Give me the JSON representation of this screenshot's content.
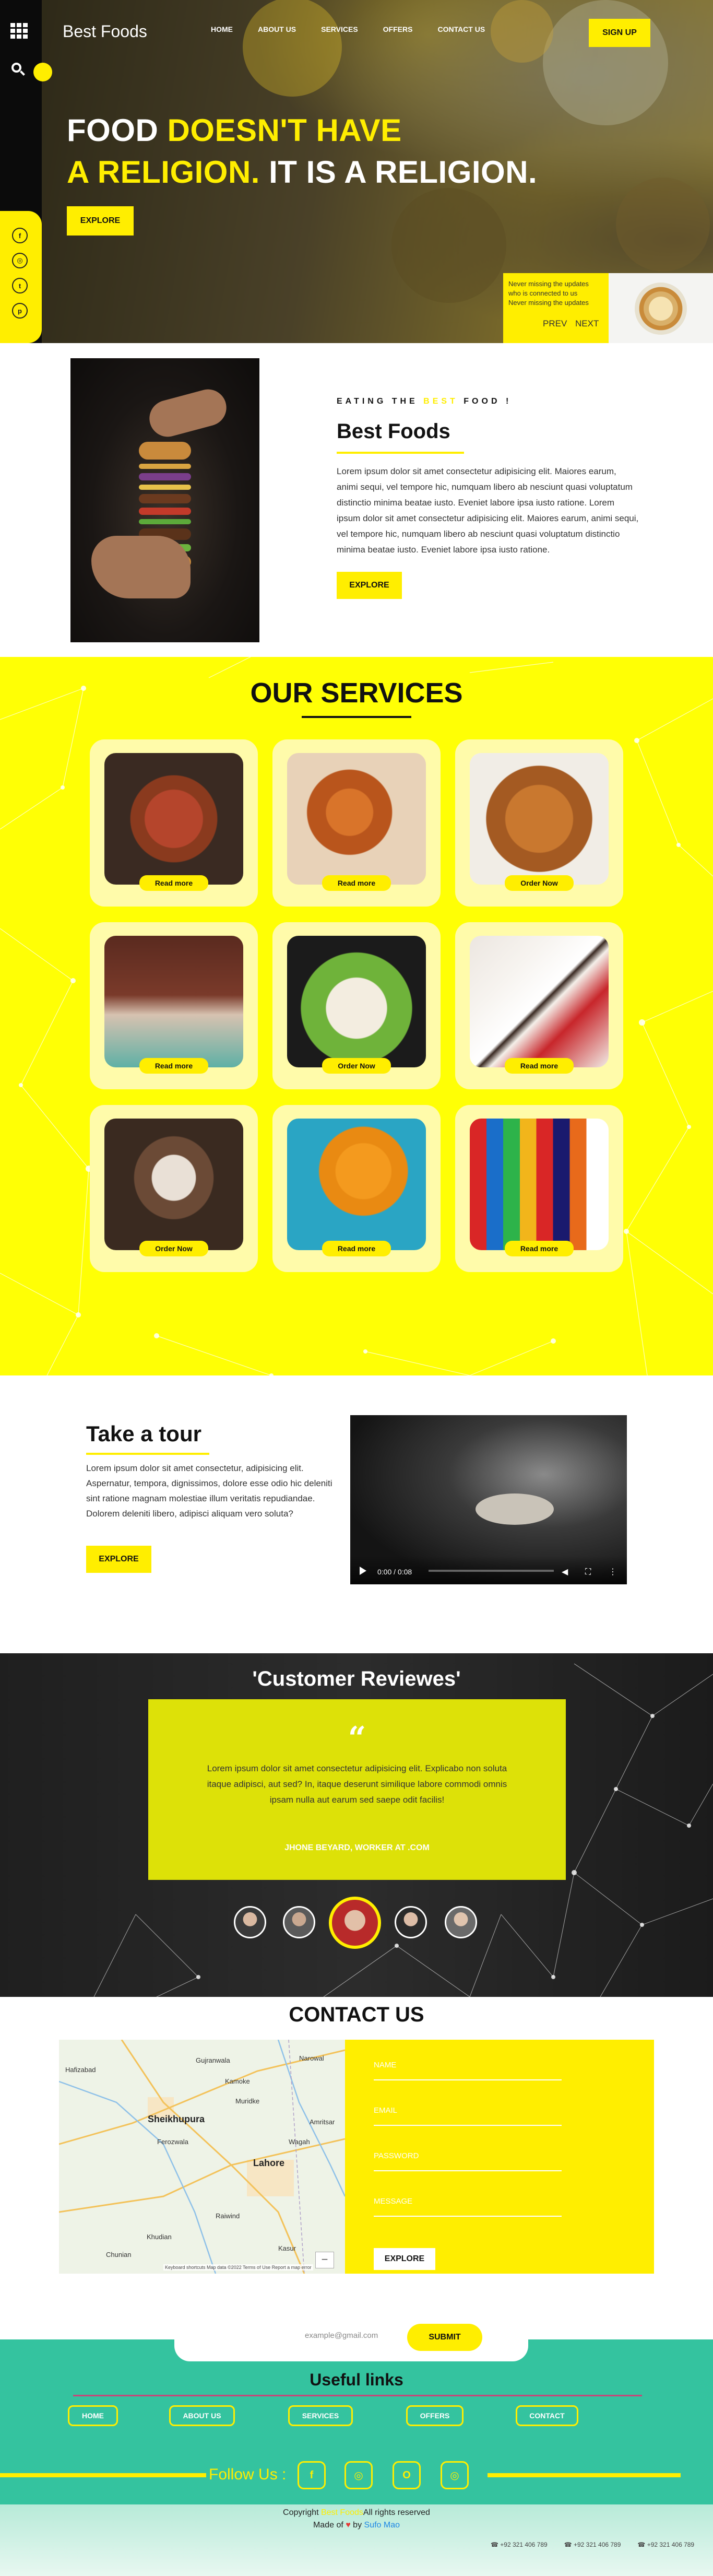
{
  "header": {
    "brand": "Best Foods",
    "nav": [
      "HOME",
      "ABOUT US",
      "SERVICES",
      "OFFERS",
      "CONTACT US"
    ],
    "signup": "SIGN UP"
  },
  "hero": {
    "line1_white": "FOOD ",
    "line1_yellow": "DOESN'T HAVE",
    "line2_yellow": "A RELIGION.",
    "line2_white": " IT IS A RELIGION.",
    "explore": "EXPLORE",
    "social": [
      "f",
      "◎",
      "t",
      "p"
    ],
    "update_lines": [
      "Never missing the updates",
      "who is connected to us",
      "Never missing the updates"
    ],
    "prev": "PREV",
    "next": "NEXT"
  },
  "about": {
    "eyebrow_1": "EATING THE ",
    "eyebrow_yellow": "BEST",
    "eyebrow_2": " FOOD !",
    "title": "Best Foods",
    "text": "Lorem ipsum dolor sit amet consectetur adipisicing elit. Maiores earum, animi sequi, vel tempore hic, numquam libero ab nesciunt quasi voluptatum distinctio minima beatae iusto. Eveniet labore ipsa iusto ratione. Lorem ipsum dolor sit amet consectetur adipisicing elit. Maiores earum, animi sequi, vel tempore hic, numquam libero ab nesciunt quasi voluptatum distinctio minima beatae iusto. Eveniet labore ipsa iusto ratione.",
    "explore": "EXPLORE"
  },
  "services": {
    "title": "OUR SERVICES",
    "cards": [
      {
        "label": "Read more",
        "icon": "pizza"
      },
      {
        "label": "Read more",
        "icon": "fried-chicken"
      },
      {
        "label": "Order Now",
        "icon": "chicken-pakora"
      },
      {
        "label": "Read more",
        "icon": "cupcakes"
      },
      {
        "label": "Order Now",
        "icon": "salad"
      },
      {
        "label": "Read more",
        "icon": "cake"
      },
      {
        "label": "Order Now",
        "icon": "milkshake"
      },
      {
        "label": "Read more",
        "icon": "orange-juice"
      },
      {
        "label": "Read more",
        "icon": "soft-drinks"
      }
    ]
  },
  "tour": {
    "title": "Take a tour",
    "text": "Lorem ipsum dolor sit amet consectetur, adipisicing elit. Aspernatur, tempora, dignissimos, dolore esse odio hic deleniti sint ratione magnam molestiae illum veritatis repudiandae. Dolorem deleniti libero, adipisci aliquam vero soluta?",
    "explore": "EXPLORE",
    "video_time": "0:00 / 0:08"
  },
  "reviews": {
    "title": "'Customer Reviewes'",
    "quote_mark": "“",
    "text": "Lorem ipsum dolor sit amet consectetur adipisicing elit. Explicabo non soluta itaque adipisci, aut sed? In, itaque deserunt similique labore commodi omnis ipsam nulla aut earum sed saepe odit facilis!",
    "author": "JHONE BEYARD, WORKER AT .COM"
  },
  "contact": {
    "title": "CONTACT US",
    "fields": [
      "NAME",
      "EMAIL",
      "PASSWORD",
      "MESSAGE"
    ],
    "send": "EXPLORE",
    "map_labels": [
      "Sheikhupura",
      "Lahore",
      "Kasur",
      "Muridke",
      "Gujranwala",
      "Kamoke",
      "Narowal",
      "Ferozwala",
      "Raiwind",
      "Wagah",
      "Hafizabad",
      "Khudian",
      "Chunian",
      "Amritsar"
    ],
    "map_credit": "Keyboard shortcuts   Map data ©2022   Terms of Use   Report a map error"
  },
  "footer": {
    "email_placeholder": "example@gmail.com",
    "submit": "SUBMIT",
    "useful_title": "Useful links",
    "links": [
      "HOME",
      "ABOUT US",
      "SERVICES",
      "OFFERS",
      "CONTACT"
    ],
    "follow": "Follow Us :",
    "follow_icons": [
      "f",
      "◎",
      "O",
      "◎"
    ],
    "copy_1": "Copyright ",
    "copy_2": "All rights reserved",
    "made_by_1": "Made of ",
    "made_by_2": " by ",
    "author": "Sufo Mao",
    "phones": [
      "+92 321 406 789",
      "+92 321 406 789",
      "+92 321 406 789"
    ]
  }
}
